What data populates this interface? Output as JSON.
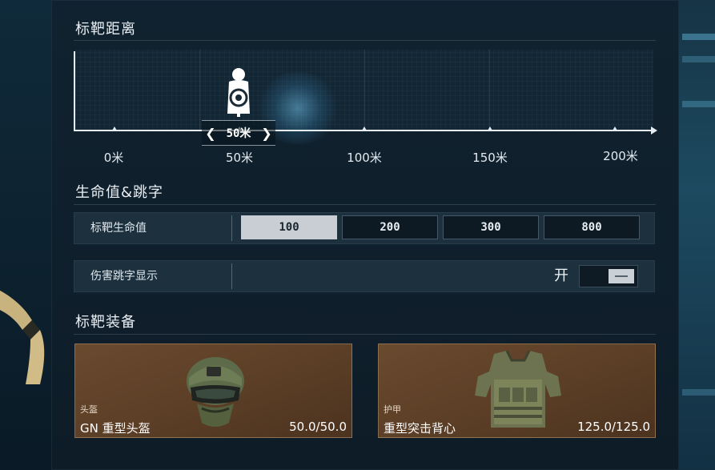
{
  "sections": {
    "distance_title": "标靶距离",
    "hp_title": "生命值&跳字",
    "equipment_title": "标靶装备"
  },
  "distance": {
    "current_label": "50米",
    "current_value_m": 50,
    "ticks": [
      "0米",
      "50米",
      "100米",
      "150米",
      "200米"
    ]
  },
  "hp_row": {
    "label": "标靶生命值",
    "options": [
      "100",
      "200",
      "300",
      "800"
    ],
    "selected": "100"
  },
  "damage_row": {
    "label": "伤害跳字显示",
    "state_text": "开",
    "enabled": true
  },
  "equipment": {
    "helmet": {
      "type": "头盔",
      "name": "GN 重型头盔",
      "durability": "50.0/50.0"
    },
    "armor": {
      "type": "护甲",
      "name": "重型突击背心",
      "durability": "125.0/125.0"
    }
  },
  "colors": {
    "panel": "#10222f",
    "selected_option": "#c8ced3",
    "card_brown": "#5b3e26"
  }
}
